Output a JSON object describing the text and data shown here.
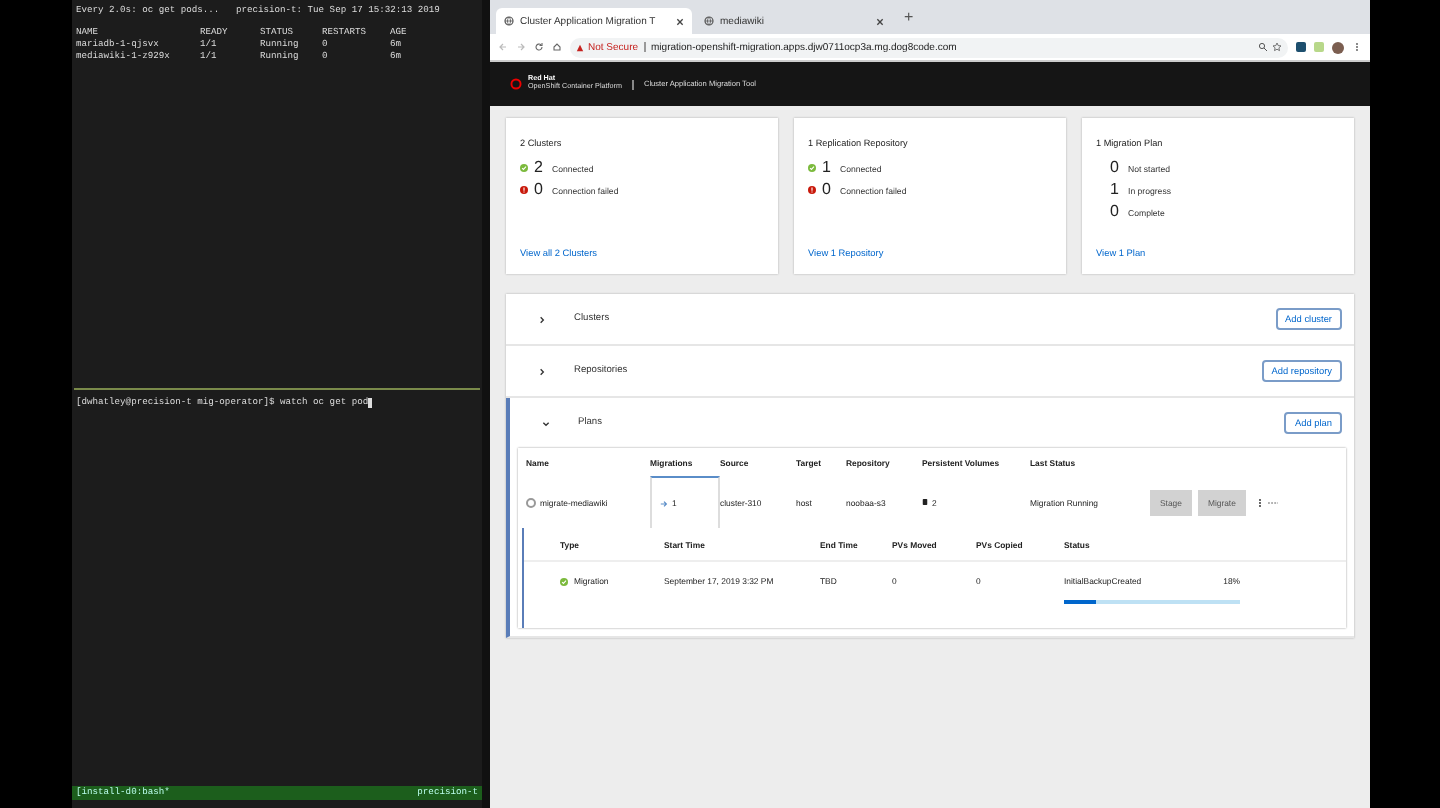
{
  "terminal": {
    "header": "Every 2.0s: oc get pods...   precision-t: Tue Sep 17 15:32:13 2019",
    "columns": [
      "NAME",
      "READY",
      "STATUS",
      "RESTARTS",
      "AGE"
    ],
    "rows": [
      [
        "mariadb-1-qjsvx",
        "1/1",
        "Running",
        "0",
        "6m"
      ],
      [
        "mediawiki-1-z929x",
        "1/1",
        "Running",
        "0",
        "6m"
      ]
    ],
    "prompt": "[dwhatley@precision-t mig-operator]$ watch oc get pod",
    "status_left": "[install-d0:bash*",
    "status_right": "precision-t"
  },
  "browser": {
    "tabs": [
      {
        "title": "Cluster Application Migration T",
        "selected": true
      },
      {
        "title": "mediawiki",
        "selected": false
      }
    ],
    "new_tab": "+",
    "security": "Not Secure",
    "url": "migration-openshift-migration.apps.djw0711ocp3a.mg.dog8code.com"
  },
  "app": {
    "brand_top": "Red Hat",
    "brand_bottom": "OpenShift Container Platform",
    "product": "Cluster Application Migration Tool",
    "cards": [
      {
        "title": "2 Clusters",
        "stats": [
          {
            "kind": "ok",
            "count": "2",
            "label": "Connected"
          },
          {
            "kind": "error",
            "count": "0",
            "label": "Connection failed"
          }
        ],
        "link": "View all 2 Clusters"
      },
      {
        "title": "1 Replication Repository",
        "stats": [
          {
            "kind": "ok",
            "count": "1",
            "label": "Connected"
          },
          {
            "kind": "error",
            "count": "0",
            "label": "Connection failed"
          }
        ],
        "link": "View 1 Repository"
      },
      {
        "title": "1 Migration Plan",
        "stats": [
          {
            "kind": "plain",
            "count": "0",
            "label": "Not started"
          },
          {
            "kind": "plain",
            "count": "1",
            "label": "In progress"
          },
          {
            "kind": "plain",
            "count": "0",
            "label": "Complete"
          }
        ],
        "link": "View 1 Plan"
      }
    ],
    "sections": [
      {
        "title": "Clusters",
        "expanded": false,
        "button": "Add cluster"
      },
      {
        "title": "Repositories",
        "expanded": false,
        "button": "Add repository"
      },
      {
        "title": "Plans",
        "expanded": true,
        "button": "Add plan"
      }
    ],
    "plans_table": {
      "columns": [
        "Name",
        "Migrations",
        "Source",
        "Target",
        "Repository",
        "Persistent Volumes",
        "Last Status"
      ],
      "row": {
        "name": "migrate-mediawiki",
        "selected": false,
        "migrations": "1",
        "migrations_selected": true,
        "source": "cluster-310",
        "target": "host",
        "repository": "noobaa-s3",
        "volumes": "2",
        "status": "Migration Running",
        "buttons": [
          "Stage",
          "Migrate"
        ]
      },
      "migrations": {
        "columns": [
          "Type",
          "Start Time",
          "End Time",
          "PVs Moved",
          "PVs Copied",
          "Status"
        ],
        "rows": [
          {
            "type": "Migration",
            "start": "September 17, 2019 3:32 PM",
            "end": "TBD",
            "moved": "0",
            "copied": "0",
            "status": "InitialBackupCreated",
            "percent": "18%",
            "level": 0.18
          }
        ]
      }
    }
  }
}
